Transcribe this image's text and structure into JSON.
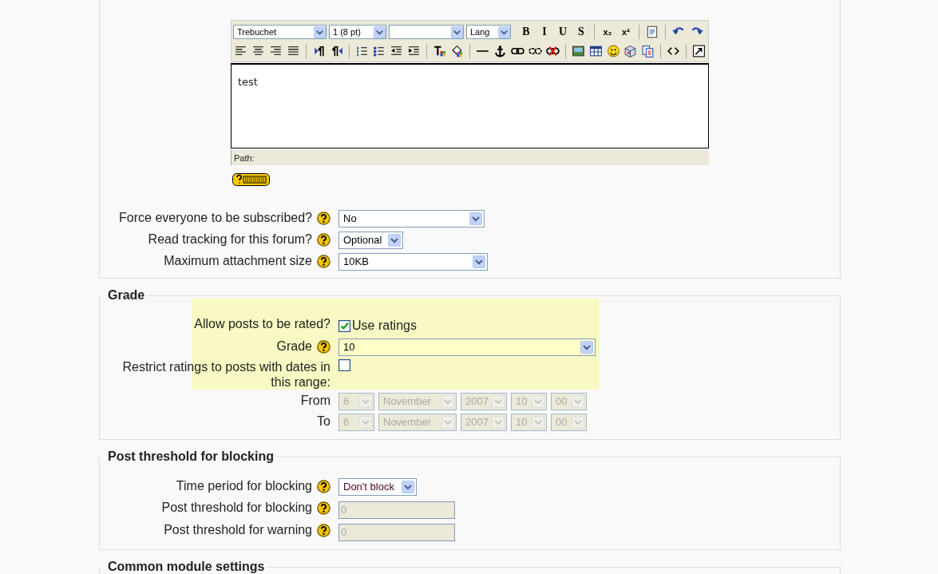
{
  "editor": {
    "toolbar": [
      [
        {
          "kind": "select",
          "value": "Trebuchet"
        },
        {
          "kind": "select",
          "value": "1 (8 pt)"
        },
        {
          "kind": "select"
        },
        {
          "kind": "select",
          "value": "Lang"
        },
        {
          "kind": "glyph",
          "text": "B"
        },
        {
          "kind": "glyph",
          "text": "I"
        },
        {
          "kind": "glyph",
          "text": "U"
        },
        {
          "kind": "glyph",
          "text": "S"
        },
        {
          "kind": "separator"
        },
        {
          "kind": "glyph",
          "text": "x₂"
        },
        {
          "kind": "glyph",
          "text": "x²"
        },
        {
          "kind": "separator"
        },
        {
          "kind": "word-paste"
        },
        {
          "kind": "separator"
        },
        {
          "kind": "undo"
        },
        {
          "kind": "redo"
        }
      ],
      [
        {
          "kind": "align-left"
        },
        {
          "kind": "align-center"
        },
        {
          "kind": "align-right"
        },
        {
          "kind": "justify"
        },
        {
          "kind": "separator"
        },
        {
          "kind": "ltr"
        },
        {
          "kind": "rtl"
        },
        {
          "kind": "separator"
        },
        {
          "kind": "ordered-list"
        },
        {
          "kind": "unordered-list"
        },
        {
          "kind": "outdent"
        },
        {
          "kind": "indent"
        },
        {
          "kind": "separator"
        },
        {
          "kind": "text-color"
        },
        {
          "kind": "background-color"
        },
        {
          "kind": "separator"
        },
        {
          "kind": "horizontal-rule"
        },
        {
          "kind": "anchor"
        },
        {
          "kind": "link"
        },
        {
          "kind": "unlink"
        },
        {
          "kind": "nolink"
        },
        {
          "kind": "separator"
        },
        {
          "kind": "image"
        },
        {
          "kind": "table"
        },
        {
          "kind": "smiley"
        },
        {
          "kind": "special-char"
        },
        {
          "kind": "paste"
        },
        {
          "kind": "separator"
        },
        {
          "kind": "html"
        },
        {
          "kind": "separator"
        },
        {
          "kind": "fullscreen"
        }
      ]
    ],
    "content": "test",
    "path_label": "Path:"
  },
  "sections": [
    {
      "rows": [
        {
          "kind": "select",
          "label": "Force everyone to be subscribed?",
          "help": true,
          "value": "No",
          "disabled": false
        },
        {
          "kind": "select",
          "label": "Read tracking for this forum?",
          "help": true,
          "value": "Optional",
          "disabled": false
        },
        {
          "kind": "select",
          "label": "Maximum attachment size",
          "help": true,
          "value": "10KB",
          "disabled": false
        }
      ]
    },
    {
      "legend": "Grade",
      "rows": [
        {
          "kind": "checkbox",
          "label": "Allow posts to be rated?",
          "help": false,
          "highlighted": true,
          "checked": true,
          "text": "Use ratings"
        },
        {
          "kind": "select",
          "label": "Grade",
          "help": true,
          "highlighted": true,
          "value": "10",
          "disabled": false
        },
        {
          "kind": "checkbox",
          "label": "Restrict ratings to posts with dates in this range:",
          "help": false,
          "highlighted": true,
          "checked": false
        },
        {
          "kind": "date",
          "label": "From",
          "help": false,
          "highlighted": false,
          "disabled": true,
          "parts": [
            "6",
            "November",
            "2007",
            "10",
            "00"
          ]
        },
        {
          "kind": "date",
          "label": "To",
          "help": false,
          "highlighted": false,
          "disabled": true,
          "parts": [
            "6",
            "November",
            "2007",
            "10",
            "00"
          ]
        }
      ]
    },
    {
      "legend": "Post threshold for blocking",
      "rows": [
        {
          "kind": "select",
          "label": "Time period for blocking",
          "help": true,
          "value": "Don't block",
          "disabled": false
        },
        {
          "kind": "text",
          "label": "Post threshold for blocking",
          "help": true,
          "value": "0",
          "disabled": true
        },
        {
          "kind": "text",
          "label": "Post threshold for warning",
          "help": true,
          "value": "0",
          "disabled": true
        }
      ]
    },
    {
      "legend": "Common module settings"
    }
  ]
}
